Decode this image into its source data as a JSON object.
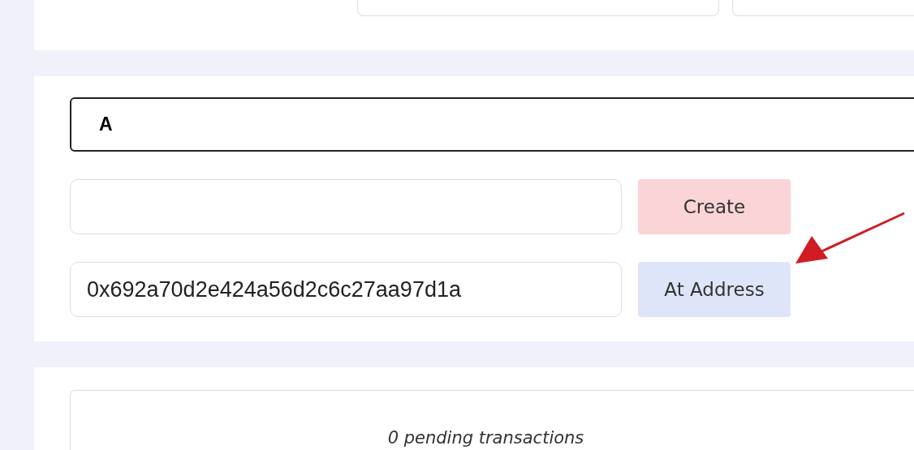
{
  "contract_field": {
    "value": "A"
  },
  "deploy_row": {
    "button": {
      "label": "Create",
      "kind": "create"
    }
  },
  "address_row": {
    "value": "0x692a70d2e424a56d2c6c27aa97d1a",
    "button": {
      "label": "At Address",
      "kind": "at-address"
    }
  },
  "pending": {
    "text": "0 pending transactions"
  }
}
